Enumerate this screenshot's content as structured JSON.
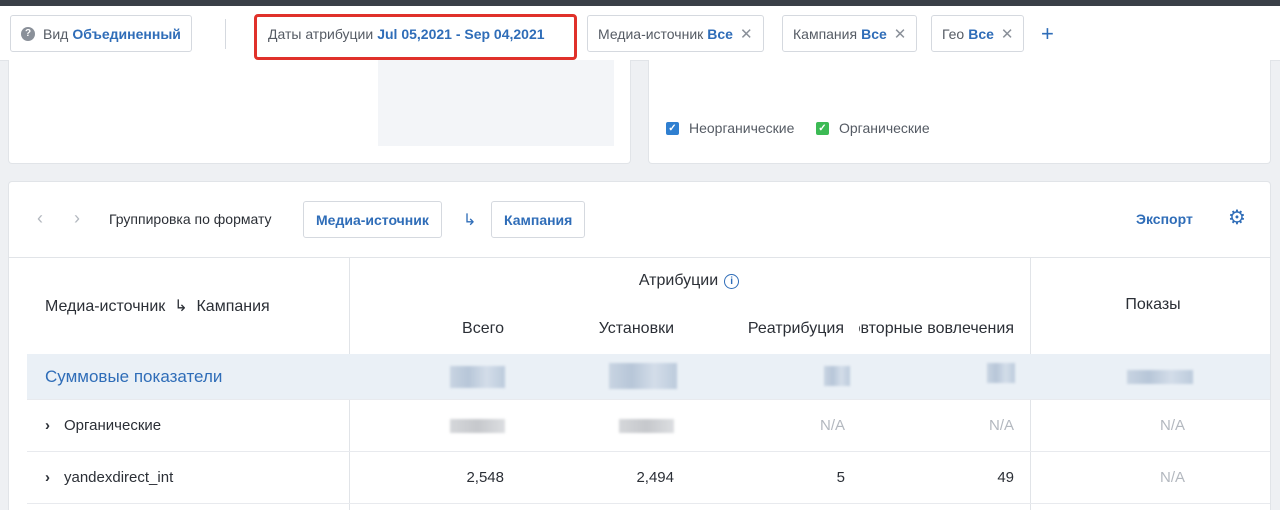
{
  "filters": {
    "view": {
      "label": "Вид",
      "value": "Объединенный"
    },
    "dates": {
      "label": "Даты атрибуции",
      "value": "Jul 05,2021 - Sep 04,2021"
    },
    "media": {
      "label": "Медиа-источник",
      "value": "Все"
    },
    "campaign": {
      "label": "Кампания",
      "value": "Все"
    },
    "geo": {
      "label": "Гео",
      "value": "Все"
    },
    "add": "+"
  },
  "legend": {
    "inorganic": {
      "label": "Неорганические",
      "color": "#2f7fd0"
    },
    "organic": {
      "label": "Органические",
      "color": "#3cba54"
    }
  },
  "toolbar": {
    "prev": "‹",
    "next": "›",
    "grouping_label": "Группировка по формату",
    "chip1": "Медиа-источник",
    "arrow": "↳",
    "chip2": "Кампания",
    "export": "Экспорт",
    "gear": "⚙"
  },
  "table": {
    "group_header": "Медиа-источник  ↳  Кампания",
    "attribution_header": "Атрибуции",
    "columns": [
      "Всего",
      "Установки",
      "Реатрибуция",
      "Повторные вовлечения"
    ],
    "impressions_header": "Показы",
    "rows": [
      {
        "name": "Суммовые показатели",
        "values": [
          "",
          "",
          "",
          ""
        ],
        "impressions": ""
      },
      {
        "name": "Органические",
        "values": [
          "",
          "",
          "N/A",
          "N/A"
        ],
        "impressions": "N/A"
      },
      {
        "name": "yandexdirect_int",
        "values": [
          "2,548",
          "2,494",
          "5",
          "49"
        ],
        "impressions": "N/A"
      }
    ]
  }
}
